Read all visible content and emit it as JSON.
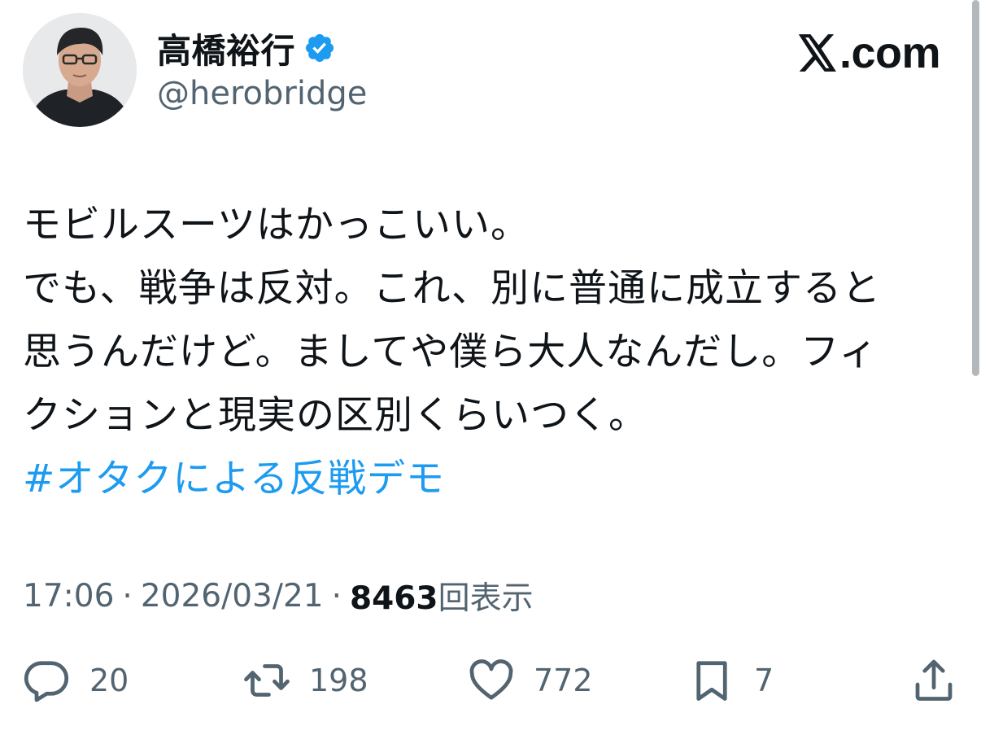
{
  "author": {
    "display_name": "高橋裕行",
    "handle": "@herobridge",
    "verified": true,
    "avatar_icon": "person-avatar-photo"
  },
  "brand": {
    "logo_icon": "x-logo-icon",
    "text": ".com"
  },
  "tweet": {
    "lines": [
      "モビルスーツはかっこいい。",
      "でも、戦争は反対。これ、別に普通に成立すると",
      "思うんだけど。ましてや僕ら大人なんだし。フィ",
      "クションと現実の区別くらいつく。"
    ],
    "hashtag": "#オタクによる反戦デモ"
  },
  "meta": {
    "time": "17:06",
    "separator": "·",
    "date": "2026/03/21",
    "views_count": "8463",
    "views_label": "回表示"
  },
  "actions": {
    "reply_count": "20",
    "retweet_count": "198",
    "like_count": "772",
    "bookmark_count": "7"
  },
  "colors": {
    "text": "#0f1419",
    "secondary": "#536471",
    "link": "#1d9bf0",
    "verified_badge": "#1d9bf0"
  }
}
